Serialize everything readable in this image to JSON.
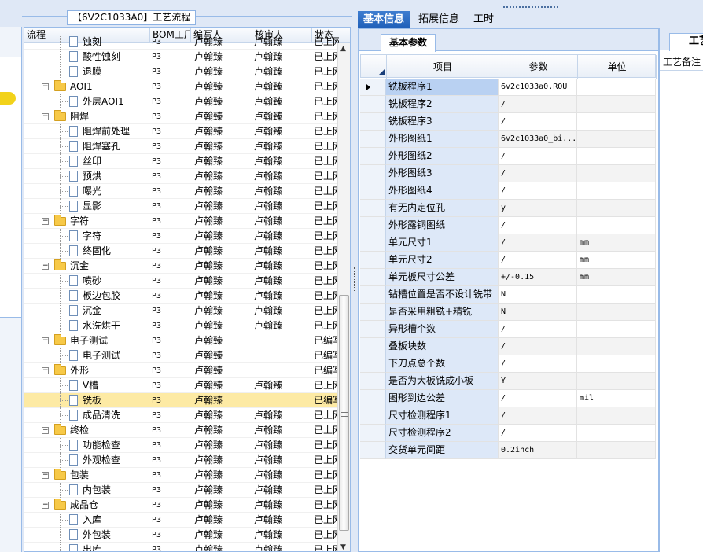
{
  "panel_title": "【6V2C1033A0】工艺流程",
  "tree": {
    "columns": [
      "流程",
      "BOM工厂",
      "编写人",
      "核审人",
      "状态"
    ],
    "rows": [
      {
        "name": "蚀刻",
        "level": 2,
        "type": "doc",
        "bom": "P3",
        "writer": "卢翰臻",
        "reviewer": "卢翰臻",
        "status": "已上网"
      },
      {
        "name": "酸性蚀刻",
        "level": 2,
        "type": "doc",
        "bom": "P3",
        "writer": "卢翰臻",
        "reviewer": "卢翰臻",
        "status": "已上网"
      },
      {
        "name": "退膜",
        "level": 2,
        "type": "doc",
        "bom": "P3",
        "writer": "卢翰臻",
        "reviewer": "卢翰臻",
        "status": "已上网"
      },
      {
        "name": "AOI1",
        "level": 1,
        "type": "folder",
        "bom": "P3",
        "writer": "卢翰臻",
        "reviewer": "卢翰臻",
        "status": "已上网"
      },
      {
        "name": "外层AOI1",
        "level": 2,
        "type": "doc",
        "bom": "P3",
        "writer": "卢翰臻",
        "reviewer": "卢翰臻",
        "status": "已上网"
      },
      {
        "name": "阻焊",
        "level": 1,
        "type": "folder",
        "bom": "P3",
        "writer": "卢翰臻",
        "reviewer": "卢翰臻",
        "status": "已上网"
      },
      {
        "name": "阻焊前处理",
        "level": 2,
        "type": "doc",
        "bom": "P3",
        "writer": "卢翰臻",
        "reviewer": "卢翰臻",
        "status": "已上网"
      },
      {
        "name": "阻焊塞孔",
        "level": 2,
        "type": "doc",
        "bom": "P3",
        "writer": "卢翰臻",
        "reviewer": "卢翰臻",
        "status": "已上网"
      },
      {
        "name": "丝印",
        "level": 2,
        "type": "doc",
        "bom": "P3",
        "writer": "卢翰臻",
        "reviewer": "卢翰臻",
        "status": "已上网"
      },
      {
        "name": "预烘",
        "level": 2,
        "type": "doc",
        "bom": "P3",
        "writer": "卢翰臻",
        "reviewer": "卢翰臻",
        "status": "已上网"
      },
      {
        "name": "曝光",
        "level": 2,
        "type": "doc",
        "bom": "P3",
        "writer": "卢翰臻",
        "reviewer": "卢翰臻",
        "status": "已上网"
      },
      {
        "name": "显影",
        "level": 2,
        "type": "doc",
        "bom": "P3",
        "writer": "卢翰臻",
        "reviewer": "卢翰臻",
        "status": "已上网"
      },
      {
        "name": "字符",
        "level": 1,
        "type": "folder",
        "bom": "P3",
        "writer": "卢翰臻",
        "reviewer": "卢翰臻",
        "status": "已上网"
      },
      {
        "name": "字符",
        "level": 2,
        "type": "doc",
        "bom": "P3",
        "writer": "卢翰臻",
        "reviewer": "卢翰臻",
        "status": "已上网"
      },
      {
        "name": "终固化",
        "level": 2,
        "type": "doc",
        "bom": "P3",
        "writer": "卢翰臻",
        "reviewer": "卢翰臻",
        "status": "已上网"
      },
      {
        "name": "沉金",
        "level": 1,
        "type": "folder",
        "bom": "P3",
        "writer": "卢翰臻",
        "reviewer": "卢翰臻",
        "status": "已上网"
      },
      {
        "name": "喷砂",
        "level": 2,
        "type": "doc",
        "bom": "P3",
        "writer": "卢翰臻",
        "reviewer": "卢翰臻",
        "status": "已上网"
      },
      {
        "name": "板边包胶",
        "level": 2,
        "type": "doc",
        "bom": "P3",
        "writer": "卢翰臻",
        "reviewer": "卢翰臻",
        "status": "已上网"
      },
      {
        "name": "沉金",
        "level": 2,
        "type": "doc",
        "bom": "P3",
        "writer": "卢翰臻",
        "reviewer": "卢翰臻",
        "status": "已上网"
      },
      {
        "name": "水洗烘干",
        "level": 2,
        "type": "doc",
        "bom": "P3",
        "writer": "卢翰臻",
        "reviewer": "卢翰臻",
        "status": "已上网"
      },
      {
        "name": "电子测试",
        "level": 1,
        "type": "folder",
        "bom": "P3",
        "writer": "卢翰臻",
        "reviewer": "",
        "status": "已编写"
      },
      {
        "name": "电子测试",
        "level": 2,
        "type": "doc",
        "bom": "P3",
        "writer": "卢翰臻",
        "reviewer": "",
        "status": "已编写"
      },
      {
        "name": "外形",
        "level": 1,
        "type": "folder",
        "bom": "P3",
        "writer": "卢翰臻",
        "reviewer": "",
        "status": "已编写"
      },
      {
        "name": "V槽",
        "level": 2,
        "type": "doc",
        "bom": "P3",
        "writer": "卢翰臻",
        "reviewer": "卢翰臻",
        "status": "已上网"
      },
      {
        "name": "铣板",
        "level": 2,
        "type": "doc",
        "bom": "P3",
        "writer": "卢翰臻",
        "reviewer": "",
        "status": "已编写",
        "selected": true
      },
      {
        "name": "成品清洗",
        "level": 2,
        "type": "doc",
        "bom": "P3",
        "writer": "卢翰臻",
        "reviewer": "卢翰臻",
        "status": "已上网"
      },
      {
        "name": "终检",
        "level": 1,
        "type": "folder",
        "bom": "P3",
        "writer": "卢翰臻",
        "reviewer": "卢翰臻",
        "status": "已上网"
      },
      {
        "name": "功能检查",
        "level": 2,
        "type": "doc",
        "bom": "P3",
        "writer": "卢翰臻",
        "reviewer": "卢翰臻",
        "status": "已上网"
      },
      {
        "name": "外观检查",
        "level": 2,
        "type": "doc",
        "bom": "P3",
        "writer": "卢翰臻",
        "reviewer": "卢翰臻",
        "status": "已上网"
      },
      {
        "name": "包装",
        "level": 1,
        "type": "folder",
        "bom": "P3",
        "writer": "卢翰臻",
        "reviewer": "卢翰臻",
        "status": "已上网"
      },
      {
        "name": "内包装",
        "level": 2,
        "type": "doc",
        "bom": "P3",
        "writer": "卢翰臻",
        "reviewer": "卢翰臻",
        "status": "已上网"
      },
      {
        "name": "成品仓",
        "level": 1,
        "type": "folder",
        "bom": "P3",
        "writer": "卢翰臻",
        "reviewer": "卢翰臻",
        "status": "已上网"
      },
      {
        "name": "入库",
        "level": 2,
        "type": "doc",
        "bom": "P3",
        "writer": "卢翰臻",
        "reviewer": "卢翰臻",
        "status": "已上网"
      },
      {
        "name": "外包装",
        "level": 2,
        "type": "doc",
        "bom": "P3",
        "writer": "卢翰臻",
        "reviewer": "卢翰臻",
        "status": "已上网"
      },
      {
        "name": "出库",
        "level": 2,
        "type": "doc",
        "bom": "P3",
        "writer": "卢翰臻",
        "reviewer": "卢翰臻",
        "status": "已上网"
      }
    ]
  },
  "right_tabs": [
    "基本信息",
    "拓展信息",
    "工时"
  ],
  "sub_tab": "基本参数",
  "param_grid": {
    "columns": [
      "项目",
      "参数",
      "单位"
    ],
    "rows": [
      {
        "item": "铣板程序1",
        "value": "6v2c1033a0.ROU",
        "unit": "",
        "current": true
      },
      {
        "item": "铣板程序2",
        "value": "/",
        "unit": ""
      },
      {
        "item": "铣板程序3",
        "value": "/",
        "unit": ""
      },
      {
        "item": "外形图纸1",
        "value": "6v2c1033a0_bi...",
        "unit": ""
      },
      {
        "item": "外形图纸2",
        "value": "/",
        "unit": ""
      },
      {
        "item": "外形图纸3",
        "value": "/",
        "unit": ""
      },
      {
        "item": "外形图纸4",
        "value": "/",
        "unit": ""
      },
      {
        "item": "有无内定位孔",
        "value": "y",
        "unit": ""
      },
      {
        "item": "外形露铜图纸",
        "value": "/",
        "unit": ""
      },
      {
        "item": "单元尺寸1",
        "value": "/",
        "unit": "mm"
      },
      {
        "item": "单元尺寸2",
        "value": "/",
        "unit": "mm"
      },
      {
        "item": "单元板尺寸公差",
        "value": "+/-0.15",
        "unit": "mm"
      },
      {
        "item": "钻槽位置是否不设计铣带",
        "value": "N",
        "unit": ""
      },
      {
        "item": "是否采用粗铣+精铣",
        "value": "N",
        "unit": ""
      },
      {
        "item": "异形槽个数",
        "value": "/",
        "unit": ""
      },
      {
        "item": "叠板块数",
        "value": "/",
        "unit": ""
      },
      {
        "item": "下刀点总个数",
        "value": "/",
        "unit": ""
      },
      {
        "item": "是否为大板铣成小板",
        "value": "Y",
        "unit": ""
      },
      {
        "item": "图形到边公差",
        "value": "/",
        "unit": "mil"
      },
      {
        "item": "尺寸检测程序1",
        "value": "/",
        "unit": ""
      },
      {
        "item": "尺寸检测程序2",
        "value": "/",
        "unit": ""
      },
      {
        "item": "交货单元间距",
        "value": "0.2inch",
        "unit": ""
      }
    ]
  },
  "far_right": {
    "tab": "工艺",
    "header": "工艺备注"
  },
  "icons": {
    "expand": "minus-box-icon",
    "folder": "folder-icon",
    "doc": "document-icon",
    "bubble": "chat-bubble-icon"
  },
  "colors": {
    "selected_row": "#fdeaa4",
    "active_tab": "#1f5fb8",
    "border": "#99bbe8"
  }
}
